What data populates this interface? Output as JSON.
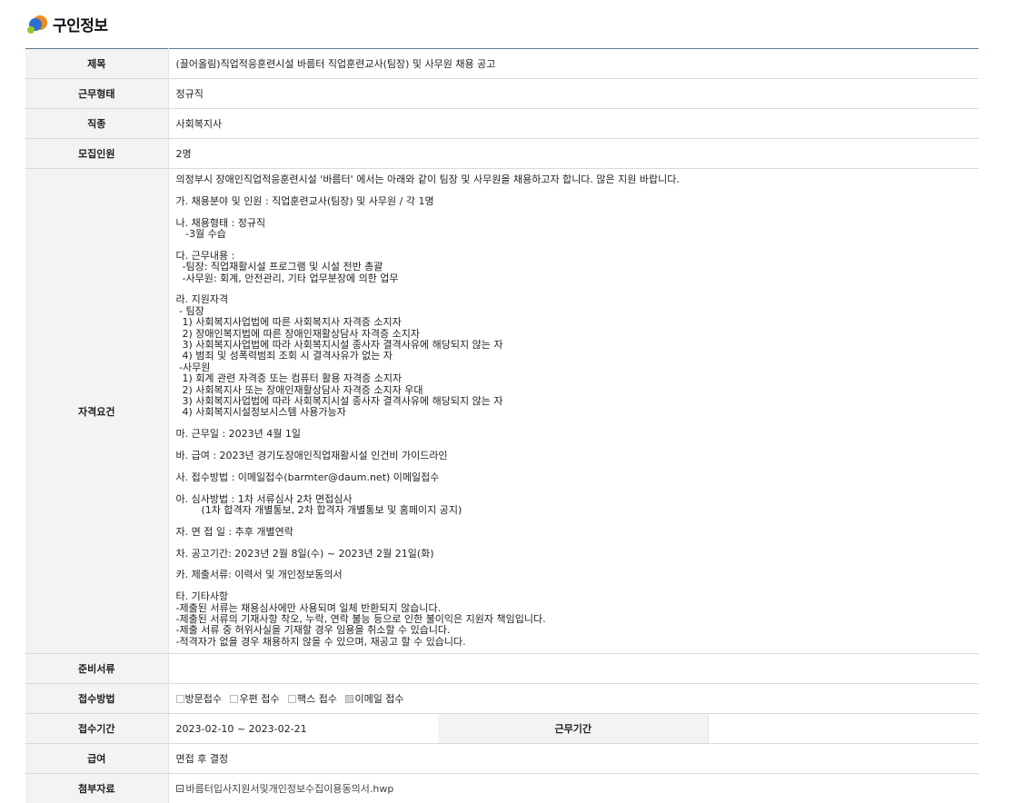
{
  "header": {
    "title": "구인정보"
  },
  "fields": {
    "title": {
      "label": "제목",
      "value": "(끌어올림)직업적응훈련시설 바름터 직업훈련교사(팀장) 및 사무원 채용 공고"
    },
    "employment_type": {
      "label": "근무형태",
      "value": "정규직"
    },
    "job_type": {
      "label": "직종",
      "value": "사회복지사"
    },
    "headcount": {
      "label": "모집인원",
      "value": "2명"
    },
    "qualifications": {
      "label": "자격요건",
      "lines": [
        "의정부시 장애인직업적응훈련시설 '바름터' 에서는 아래와 같이 팀장 및 사무원을 채용하고자 합니다. 많은 지원 바랍니다.",
        "가. 채용분야 및 인원 : 직업훈련교사(팀장) 및 사무원 / 각 1명",
        "나. 채용형태 : 정규직",
        "   -3월 수습",
        "다. 근무내용 :",
        "  -팀장: 직업재활시설 프로그램 및 시설 전반 총괄",
        "  -사무원: 회계, 안전관리, 기타 업무분장에 의한 업무",
        "라. 지원자격",
        " - 팀장",
        "  1) 사회복지사업법에 따른 사회복지사 자격증 소지자",
        "  2) 장애인복지법에 따른 장애인재활상담사 자격증 소지자",
        "  3) 사회복지사업법에 따라 사회복지시설 종사자 결격사유에 해당되지 않는 자",
        "  4) 범죄 및 성폭력범죄 조회 시 결격사유가 없는 자",
        " -사무원",
        "  1) 회계 관련 자격증 또는 컴퓨터 활용 자격증 소지자",
        "  2) 사회복지사 또는 장애인재활상담사 자격증 소지자 우대",
        "  3) 사회복지사업법에 따라 사회복지시설 종사자 결격사유에 해당되지 않는 자",
        "  4) 사회복지시설정보시스템 사용가능자",
        "마. 근무일 : 2023년 4월 1일",
        "바. 급여 : 2023년 경기도장애인직업재활시설 인건비 가이드라인",
        "사. 접수방법 : 이메일접수(barmter@daum.net) 이메일접수",
        "아. 심사방법 : 1차 서류심사 2차 면접심사",
        "        (1차 합격자 개별통보, 2차 합격자 개별통보 및 홈페이지 공지)",
        "자. 면 접 일 : 추후 개별연락",
        "차. 공고기간: 2023년 2월 8일(수) ~ 2023년 2월 21일(화)",
        "카. 제출서류: 이력서 및 개인정보동의서",
        "타. 기타사항",
        "-제출된 서류는 채용심사에만 사용되며 일체 반환되지 않습니다.",
        "-제출된 서류의 기재사항 착오, 누락, 연락 불능 등으로 인한 불이익은 지원자 책임입니다.",
        "-제출 서류 중 허위사실을 기재할 경우 임용을 취소할 수 있습니다.",
        "-적격자가 없을 경우 채용하지 않을 수 있으며, 재공고 할 수 있습니다."
      ]
    },
    "documents": {
      "label": "준비서류",
      "value": ""
    },
    "method": {
      "label": "접수방법",
      "options": [
        {
          "label": "방문접수",
          "checked": false
        },
        {
          "label": "우편 접수",
          "checked": false
        },
        {
          "label": "팩스 접수",
          "checked": false
        },
        {
          "label": "이메일 접수",
          "checked": true
        }
      ]
    },
    "period": {
      "label": "접수기간",
      "value": "2023-02-10 ~ 2023-02-21",
      "work_label": "근무기간",
      "work_value": ""
    },
    "salary": {
      "label": "급여",
      "value": "면접 후 결정"
    },
    "attachment": {
      "label": "첨부자료",
      "file": "바름터입사지원서및개인정보수집이용동의서.hwp"
    }
  }
}
